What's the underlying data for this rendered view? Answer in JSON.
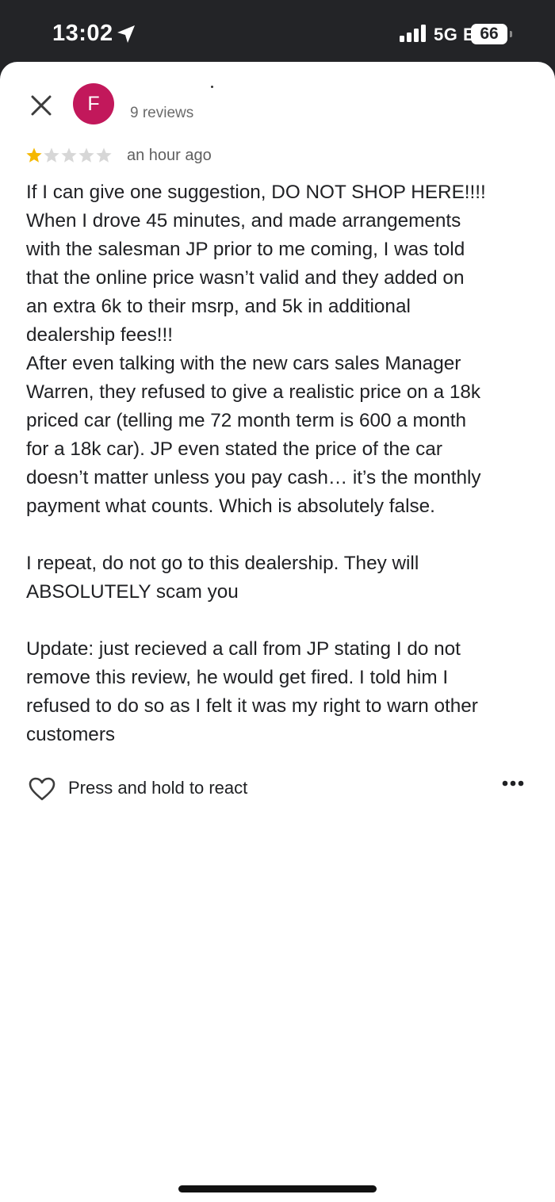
{
  "status_bar": {
    "time": "13:02",
    "network": "5G E",
    "battery": "66"
  },
  "reviewer": {
    "avatar_letter": "F",
    "reviews_count": "9 reviews"
  },
  "review": {
    "rating": 1,
    "rating_max": 5,
    "time": "an hour ago",
    "paragraph_1": "If I can give one suggestion, DO NOT SHOP HERE!!!!\nWhen I drove 45 minutes, and made arrangements\nwith the salesman JP prior to me coming, I was told\nthat the online price wasn’t valid and they added on\nan extra 6k to their msrp, and 5k in additional\ndealership fees!!!\nAfter even talking with the new cars sales Manager\nWarren, they refused to give a realistic price on a 18k\npriced car (telling me 72 month term is 600 a month\nfor a 18k car). JP even stated the price of the car\ndoesn’t matter unless you pay cash… it’s the monthly\npayment what counts. Which is absolutely false.",
    "paragraph_2": "I repeat, do not go to this dealership. They will\nABSOLUTELY scam you",
    "paragraph_3": "Update: just recieved a call from JP stating I do not\nremove this review, he would get fired. I told him I\nrefused to do so as I felt it was my right to warn other\ncustomers"
  },
  "actions": {
    "react_label": "Press and hold to react"
  },
  "icons": {
    "close": "close-icon",
    "heart": "heart-icon",
    "more": "more-options-icon",
    "location": "location-arrow-icon",
    "signal": "signal-bars-icon"
  },
  "colors": {
    "avatar": "#c2185b",
    "star_filled": "#f5b800",
    "star_empty": "#d7d7d7"
  }
}
